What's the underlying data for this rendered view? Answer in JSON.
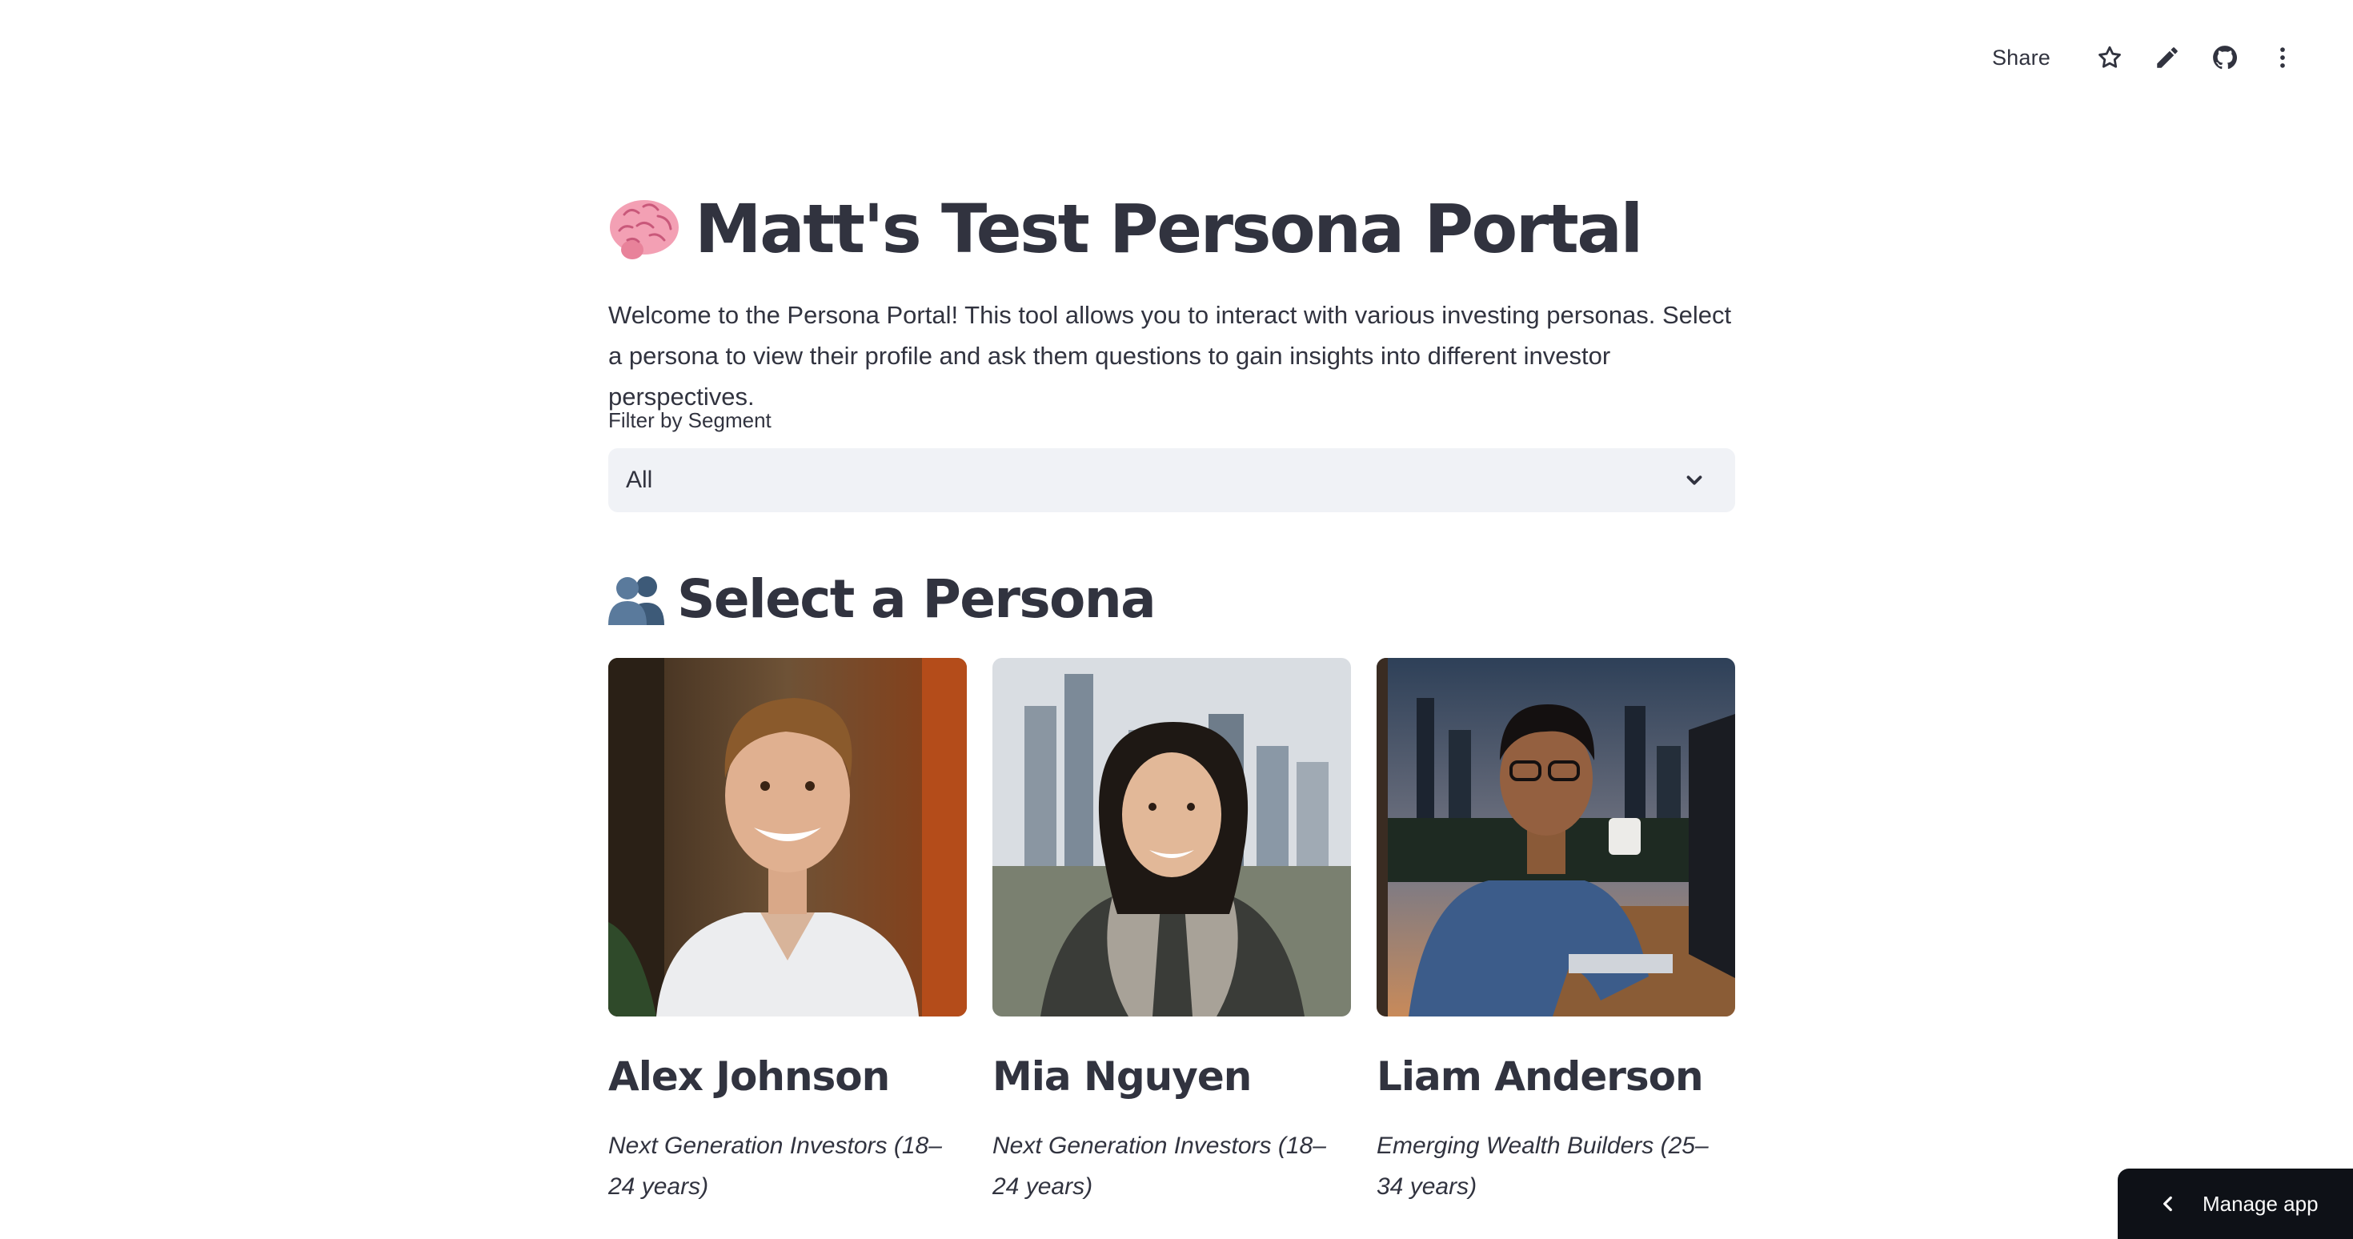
{
  "toolbar": {
    "share_label": "Share",
    "icons": [
      "star-icon",
      "pencil-icon",
      "github-icon",
      "more-vertical-icon"
    ]
  },
  "page": {
    "title": "Matt's Test Persona Portal",
    "title_emoji": "brain",
    "intro": "Welcome to the Persona Portal! This tool allows you to interact with various investing personas. Select a persona to view their profile and ask them questions to gain insights into different investor perspectives."
  },
  "filter": {
    "label": "Filter by Segment",
    "selected": "All"
  },
  "section": {
    "title": "Select a Persona",
    "emoji": "people"
  },
  "personas": [
    {
      "name": "Alex Johnson",
      "segment": "Next Generation Investors (18–24 years)"
    },
    {
      "name": "Mia Nguyen",
      "segment": "Next Generation Investors (18–24 years)"
    },
    {
      "name": "Liam Anderson",
      "segment": "Emerging Wealth Builders (25–34 years)"
    }
  ],
  "footer": {
    "manage_label": "Manage app"
  },
  "colors": {
    "text": "#31333f",
    "select_bg": "#f0f2f6",
    "manage_bg": "#0e1117"
  }
}
